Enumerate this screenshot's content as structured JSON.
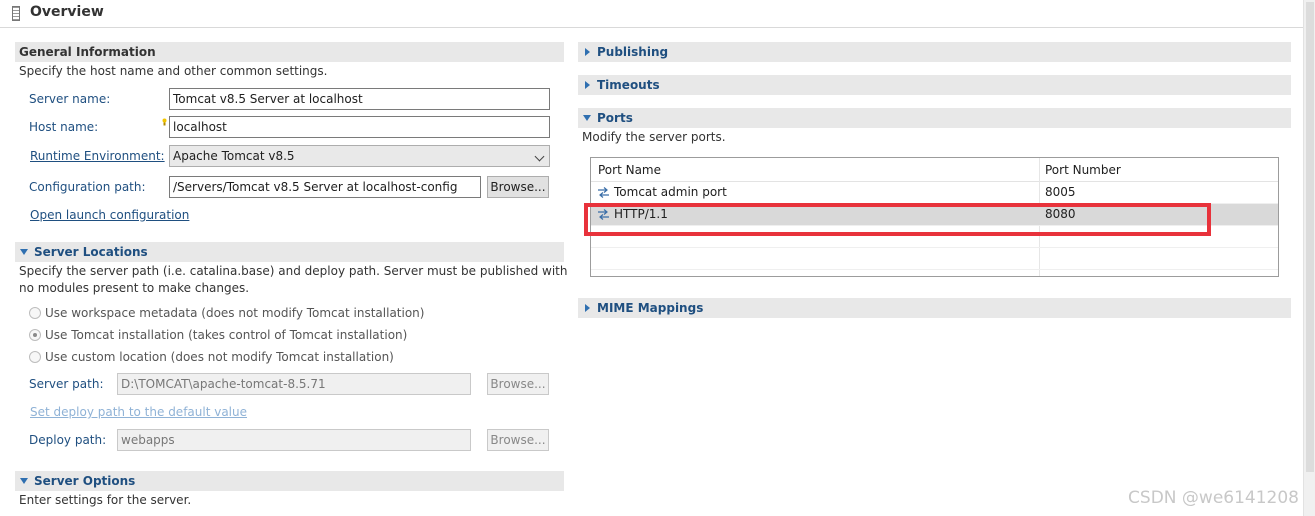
{
  "editor": {
    "title": "Overview"
  },
  "general": {
    "header": "General Information",
    "description": "Specify the host name and other common settings.",
    "server_name_label": "Server name:",
    "server_name_value": "Tomcat v8.5 Server at localhost",
    "host_name_label": "Host name:",
    "host_name_value": "localhost",
    "runtime_label": "Runtime Environment:",
    "runtime_value": "Apache Tomcat v8.5",
    "config_label": "Configuration path:",
    "config_value": "/Servers/Tomcat v8.5 Server at localhost-config",
    "browse_label": "Browse...",
    "open_launch_label": "Open launch configuration"
  },
  "locations": {
    "header": "Server Locations",
    "description_line1": "Specify the server path (i.e. catalina.base) and deploy path. Server must be published with",
    "description_line2": "no modules present to make changes.",
    "options": [
      {
        "label": "Use workspace metadata (does not modify Tomcat installation)",
        "selected": false
      },
      {
        "label": "Use Tomcat installation (takes control of Tomcat installation)",
        "selected": true
      },
      {
        "label": "Use custom location (does not modify Tomcat installation)",
        "selected": false
      }
    ],
    "server_path_label": "Server path:",
    "server_path_value": "D:\\TOMCAT\\apache-tomcat-8.5.71",
    "browse_label": "Browse...",
    "set_deploy_label": "Set deploy path to the default value",
    "deploy_path_label": "Deploy path:",
    "deploy_path_value": "webapps"
  },
  "options": {
    "header": "Server Options",
    "description": "Enter settings for the server."
  },
  "publishing": {
    "header": "Publishing"
  },
  "timeouts": {
    "header": "Timeouts"
  },
  "ports": {
    "header": "Ports",
    "description": "Modify the server ports.",
    "columns": [
      "Port Name",
      "Port Number"
    ],
    "rows": [
      {
        "name": "Tomcat admin port",
        "number": "8005"
      },
      {
        "name": "HTTP/1.1",
        "number": "8080"
      }
    ]
  },
  "mime": {
    "header": "MIME Mappings"
  },
  "watermark": "CSDN @we6141208",
  "colors": {
    "link": "#1f4f80",
    "highlight": "#e8323b",
    "section_bg": "#e8e8e8"
  }
}
